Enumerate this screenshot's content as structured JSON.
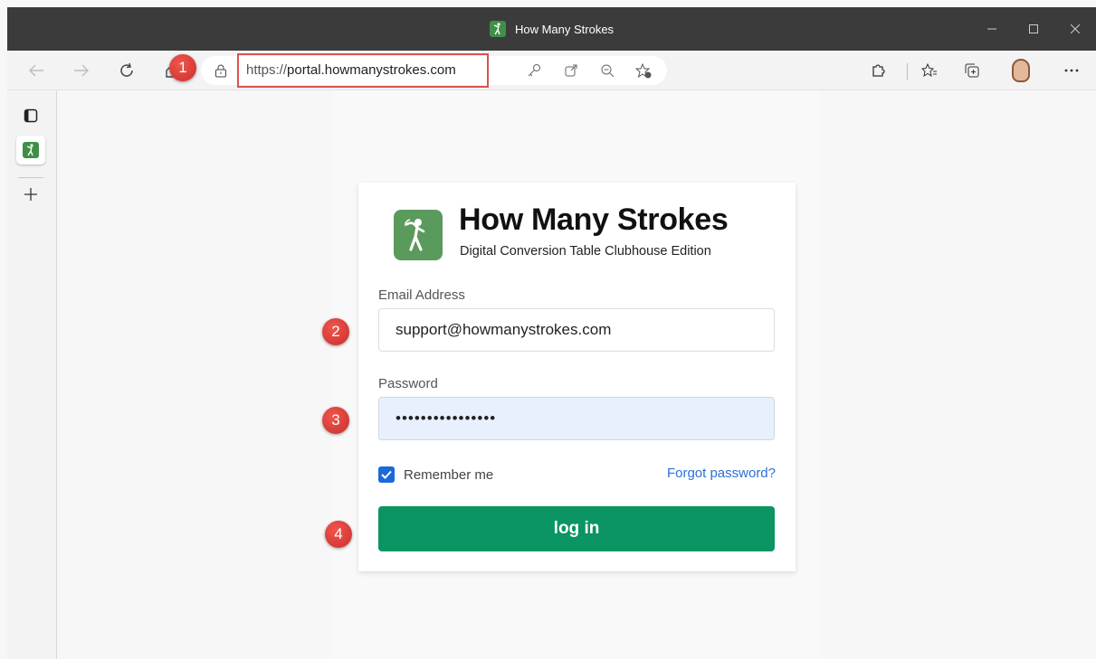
{
  "window": {
    "title": "How Many Strokes",
    "favicon": "golfer-icon",
    "controls": [
      "minimize-icon",
      "maximize-icon",
      "close-icon"
    ]
  },
  "toolbar": {
    "url_scheme": "https://",
    "url_host": "portal.howmanystrokes.com",
    "icons": [
      "back-icon",
      "forward-icon",
      "refresh-icon",
      "lock-icon",
      "key-icon",
      "open-external-icon",
      "zoom-out-icon",
      "add-favorite-icon",
      "extensions-icon",
      "favorites-icon",
      "collections-icon",
      "profile-avatar",
      "more-icon"
    ]
  },
  "login": {
    "brand_title": "How Many Strokes",
    "brand_subtitle": "Digital Conversion Table Clubhouse Edition",
    "email_label": "Email Address",
    "email_value": "support@howmanystrokes.com",
    "password_label": "Password",
    "password_value": "••••••••••••••••",
    "remember_label": "Remember me",
    "remember_checked": true,
    "forgot_label": "Forgot password?",
    "login_label": "log in"
  },
  "annotations": [
    "1",
    "2",
    "3",
    "4"
  ],
  "colors": {
    "brand_green": "#5b9a5d",
    "login_button": "#0a9563",
    "link_blue": "#2b6fd6",
    "marker_red": "#d9534f"
  }
}
